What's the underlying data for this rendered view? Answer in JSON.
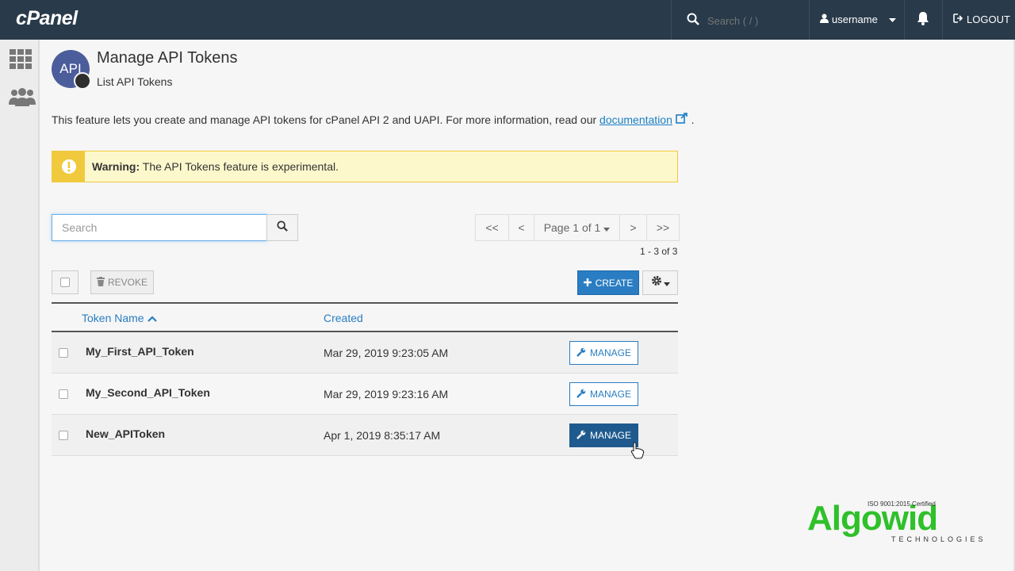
{
  "topbar": {
    "logo": "cPanel",
    "search_placeholder": "Search ( / )",
    "username": "username",
    "logout": "LOGOUT"
  },
  "header": {
    "icon_text": "API",
    "title": "Manage API Tokens",
    "subtitle": "List API Tokens"
  },
  "intro": {
    "text": "This feature lets you create and manage API tokens for cPanel API 2 and UAPI. For more information, read our ",
    "link": "documentation",
    "end": "."
  },
  "warning": {
    "label": "Warning:",
    "text": " The API Tokens feature is experimental."
  },
  "search": {
    "placeholder": "Search"
  },
  "pager": {
    "first": "<<",
    "prev": "<",
    "page": "Page 1 of 1",
    "next": ">",
    "last": ">>",
    "range": "1 - 3 of 3"
  },
  "toolbar": {
    "revoke": "REVOKE",
    "create": "CREATE"
  },
  "table": {
    "columns": [
      "Token Name",
      "Created"
    ],
    "manage_label": "MANAGE",
    "rows": [
      {
        "name": "My_First_API_Token",
        "created": "Mar 29, 2019 9:23:05 AM"
      },
      {
        "name": "My_Second_API_Token",
        "created": "Mar 29, 2019 9:23:16 AM"
      },
      {
        "name": "New_APIToken",
        "created": "Apr 1, 2019 8:35:17 AM"
      }
    ]
  },
  "watermark": {
    "cert": "ISO 9001:2015 Certified",
    "name": "Algowid",
    "tagline": "TECHNOLOGIES"
  },
  "colors": {
    "topbar": "#293a4a",
    "primary": "#2a7dc2",
    "warning": "#f0c93c",
    "watermark": "#2fc02a"
  }
}
